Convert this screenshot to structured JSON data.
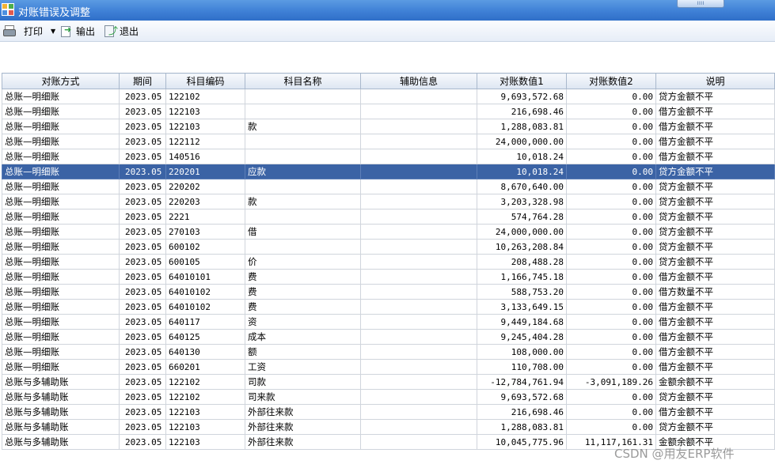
{
  "window": {
    "title": "对账错误及调整"
  },
  "toolbar": {
    "print_label": "打印",
    "export_label": "输出",
    "exit_label": "退出",
    "icons": [
      "printer-icon",
      "export-icon",
      "exit-icon"
    ]
  },
  "table": {
    "columns": [
      "对账方式",
      "期间",
      "科目编码",
      "科目名称",
      "辅助信息",
      "对账数值1",
      "对账数值2",
      "说明"
    ],
    "selected_row": 5,
    "rows": [
      [
        "总账—明细账",
        "2023.05",
        "122102",
        "",
        "",
        "9,693,572.68",
        "0.00",
        "贷方金额不平"
      ],
      [
        "总账—明细账",
        "2023.05",
        "122103",
        "",
        "",
        "216,698.46",
        "0.00",
        "借方金额不平"
      ],
      [
        "总账—明细账",
        "2023.05",
        "122103",
        "款",
        "",
        "1,288,083.81",
        "0.00",
        "借方金额不平"
      ],
      [
        "总账—明细账",
        "2023.05",
        "122112",
        "",
        "",
        "24,000,000.00",
        "0.00",
        "借方金额不平"
      ],
      [
        "总账—明细账",
        "2023.05",
        "140516",
        "",
        "",
        "10,018.24",
        "0.00",
        "借方金额不平"
      ],
      [
        "总账—明细账",
        "2023.05",
        "220201",
        "应款",
        "",
        "10,018.24",
        "0.00",
        "贷方金额不平"
      ],
      [
        "总账—明细账",
        "2023.05",
        "220202",
        "",
        "",
        "8,670,640.00",
        "0.00",
        "贷方金额不平"
      ],
      [
        "总账—明细账",
        "2023.05",
        "220203",
        "款",
        "",
        "3,203,328.98",
        "0.00",
        "贷方金额不平"
      ],
      [
        "总账—明细账",
        "2023.05",
        "2221",
        "",
        "",
        "574,764.28",
        "0.00",
        "贷方金额不平"
      ],
      [
        "总账—明细账",
        "2023.05",
        "270103",
        "借",
        "",
        "24,000,000.00",
        "0.00",
        "贷方金额不平"
      ],
      [
        "总账—明细账",
        "2023.05",
        "600102",
        "",
        "",
        "10,263,208.84",
        "0.00",
        "贷方金额不平"
      ],
      [
        "总账—明细账",
        "2023.05",
        "600105",
        "价",
        "",
        "208,488.28",
        "0.00",
        "贷方金额不平"
      ],
      [
        "总账—明细账",
        "2023.05",
        "64010101",
        "费",
        "",
        "1,166,745.18",
        "0.00",
        "借方金额不平"
      ],
      [
        "总账—明细账",
        "2023.05",
        "64010102",
        "费",
        "",
        "588,753.20",
        "0.00",
        "借方数量不平"
      ],
      [
        "总账—明细账",
        "2023.05",
        "64010102",
        "费",
        "",
        "3,133,649.15",
        "0.00",
        "借方金额不平"
      ],
      [
        "总账—明细账",
        "2023.05",
        "640117",
        "资",
        "",
        "9,449,184.68",
        "0.00",
        "借方金额不平"
      ],
      [
        "总账—明细账",
        "2023.05",
        "640125",
        "成本",
        "",
        "9,245,404.28",
        "0.00",
        "借方金额不平"
      ],
      [
        "总账—明细账",
        "2023.05",
        "640130",
        "额",
        "",
        "108,000.00",
        "0.00",
        "借方金额不平"
      ],
      [
        "总账—明细账",
        "2023.05",
        "660201",
        "工资",
        "",
        "110,708.00",
        "0.00",
        "借方金额不平"
      ],
      [
        "总账与多辅助账",
        "2023.05",
        "122102",
        "司款",
        "",
        "-12,784,761.94",
        "-3,091,189.26",
        "金额余额不平"
      ],
      [
        "总账与多辅助账",
        "2023.05",
        "122102",
        "司来款",
        "",
        "9,693,572.68",
        "0.00",
        "贷方金额不平"
      ],
      [
        "总账与多辅助账",
        "2023.05",
        "122103",
        "外部往来款",
        "",
        "216,698.46",
        "0.00",
        "借方金额不平"
      ],
      [
        "总账与多辅助账",
        "2023.05",
        "122103",
        "外部往来款",
        "",
        "1,288,083.81",
        "0.00",
        "贷方金额不平"
      ],
      [
        "总账与多辅助账",
        "2023.05",
        "122103",
        "外部往来款",
        "",
        "10,045,775.96",
        "11,117,161.31",
        "金额余额不平"
      ]
    ]
  },
  "watermark": "CSDN @用友ERP软件"
}
